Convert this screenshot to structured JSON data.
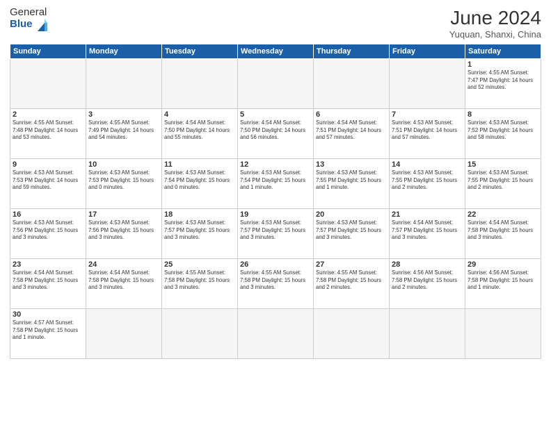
{
  "header": {
    "logo_general": "General",
    "logo_blue": "Blue",
    "title": "June 2024",
    "location": "Yuquan, Shanxi, China"
  },
  "days_of_week": [
    "Sunday",
    "Monday",
    "Tuesday",
    "Wednesday",
    "Thursday",
    "Friday",
    "Saturday"
  ],
  "weeks": [
    [
      {
        "num": "",
        "info": ""
      },
      {
        "num": "",
        "info": ""
      },
      {
        "num": "",
        "info": ""
      },
      {
        "num": "",
        "info": ""
      },
      {
        "num": "",
        "info": ""
      },
      {
        "num": "",
        "info": ""
      },
      {
        "num": "1",
        "info": "Sunrise: 4:55 AM\nSunset: 7:47 PM\nDaylight: 14 hours\nand 52 minutes."
      }
    ],
    [
      {
        "num": "2",
        "info": "Sunrise: 4:55 AM\nSunset: 7:48 PM\nDaylight: 14 hours\nand 53 minutes."
      },
      {
        "num": "3",
        "info": "Sunrise: 4:55 AM\nSunset: 7:49 PM\nDaylight: 14 hours\nand 54 minutes."
      },
      {
        "num": "4",
        "info": "Sunrise: 4:54 AM\nSunset: 7:50 PM\nDaylight: 14 hours\nand 55 minutes."
      },
      {
        "num": "5",
        "info": "Sunrise: 4:54 AM\nSunset: 7:50 PM\nDaylight: 14 hours\nand 56 minutes."
      },
      {
        "num": "6",
        "info": "Sunrise: 4:54 AM\nSunset: 7:51 PM\nDaylight: 14 hours\nand 57 minutes."
      },
      {
        "num": "7",
        "info": "Sunrise: 4:53 AM\nSunset: 7:51 PM\nDaylight: 14 hours\nand 57 minutes."
      },
      {
        "num": "8",
        "info": "Sunrise: 4:53 AM\nSunset: 7:52 PM\nDaylight: 14 hours\nand 58 minutes."
      }
    ],
    [
      {
        "num": "9",
        "info": "Sunrise: 4:53 AM\nSunset: 7:53 PM\nDaylight: 14 hours\nand 59 minutes."
      },
      {
        "num": "10",
        "info": "Sunrise: 4:53 AM\nSunset: 7:53 PM\nDaylight: 15 hours\nand 0 minutes."
      },
      {
        "num": "11",
        "info": "Sunrise: 4:53 AM\nSunset: 7:54 PM\nDaylight: 15 hours\nand 0 minutes."
      },
      {
        "num": "12",
        "info": "Sunrise: 4:53 AM\nSunset: 7:54 PM\nDaylight: 15 hours\nand 1 minute."
      },
      {
        "num": "13",
        "info": "Sunrise: 4:53 AM\nSunset: 7:55 PM\nDaylight: 15 hours\nand 1 minute."
      },
      {
        "num": "14",
        "info": "Sunrise: 4:53 AM\nSunset: 7:55 PM\nDaylight: 15 hours\nand 2 minutes."
      },
      {
        "num": "15",
        "info": "Sunrise: 4:53 AM\nSunset: 7:55 PM\nDaylight: 15 hours\nand 2 minutes."
      }
    ],
    [
      {
        "num": "16",
        "info": "Sunrise: 4:53 AM\nSunset: 7:56 PM\nDaylight: 15 hours\nand 3 minutes."
      },
      {
        "num": "17",
        "info": "Sunrise: 4:53 AM\nSunset: 7:56 PM\nDaylight: 15 hours\nand 3 minutes."
      },
      {
        "num": "18",
        "info": "Sunrise: 4:53 AM\nSunset: 7:57 PM\nDaylight: 15 hours\nand 3 minutes."
      },
      {
        "num": "19",
        "info": "Sunrise: 4:53 AM\nSunset: 7:57 PM\nDaylight: 15 hours\nand 3 minutes."
      },
      {
        "num": "20",
        "info": "Sunrise: 4:53 AM\nSunset: 7:57 PM\nDaylight: 15 hours\nand 3 minutes."
      },
      {
        "num": "21",
        "info": "Sunrise: 4:54 AM\nSunset: 7:57 PM\nDaylight: 15 hours\nand 3 minutes."
      },
      {
        "num": "22",
        "info": "Sunrise: 4:54 AM\nSunset: 7:58 PM\nDaylight: 15 hours\nand 3 minutes."
      }
    ],
    [
      {
        "num": "23",
        "info": "Sunrise: 4:54 AM\nSunset: 7:58 PM\nDaylight: 15 hours\nand 3 minutes."
      },
      {
        "num": "24",
        "info": "Sunrise: 4:54 AM\nSunset: 7:58 PM\nDaylight: 15 hours\nand 3 minutes."
      },
      {
        "num": "25",
        "info": "Sunrise: 4:55 AM\nSunset: 7:58 PM\nDaylight: 15 hours\nand 3 minutes."
      },
      {
        "num": "26",
        "info": "Sunrise: 4:55 AM\nSunset: 7:58 PM\nDaylight: 15 hours\nand 3 minutes."
      },
      {
        "num": "27",
        "info": "Sunrise: 4:55 AM\nSunset: 7:58 PM\nDaylight: 15 hours\nand 2 minutes."
      },
      {
        "num": "28",
        "info": "Sunrise: 4:56 AM\nSunset: 7:58 PM\nDaylight: 15 hours\nand 2 minutes."
      },
      {
        "num": "29",
        "info": "Sunrise: 4:56 AM\nSunset: 7:58 PM\nDaylight: 15 hours\nand 1 minute."
      }
    ],
    [
      {
        "num": "30",
        "info": "Sunrise: 4:57 AM\nSunset: 7:58 PM\nDaylight: 15 hours\nand 1 minute."
      },
      {
        "num": "",
        "info": ""
      },
      {
        "num": "",
        "info": ""
      },
      {
        "num": "",
        "info": ""
      },
      {
        "num": "",
        "info": ""
      },
      {
        "num": "",
        "info": ""
      },
      {
        "num": "",
        "info": ""
      }
    ]
  ]
}
